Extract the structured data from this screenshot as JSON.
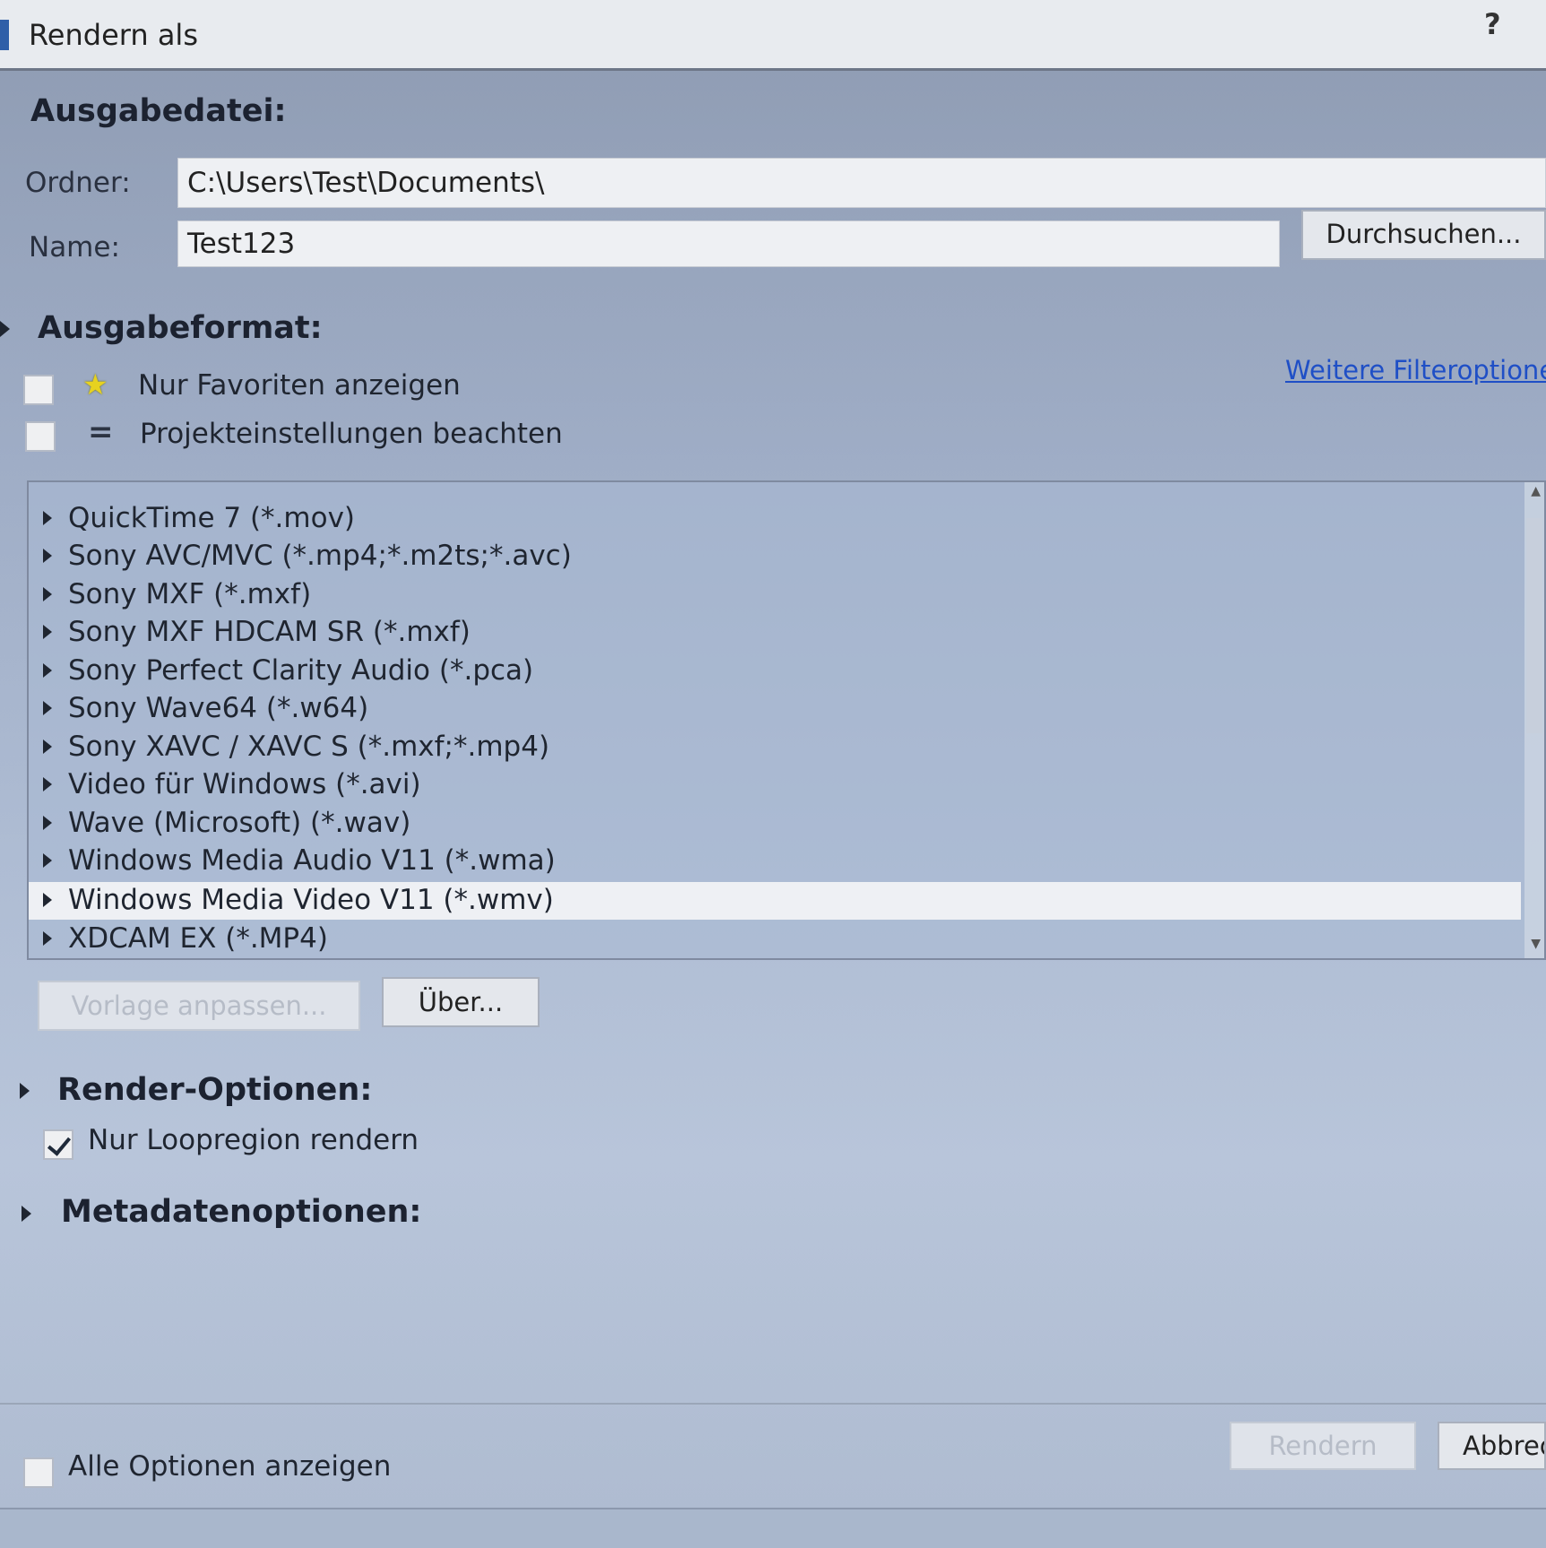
{
  "window": {
    "title": "Rendern als",
    "help": "?"
  },
  "output_file": {
    "heading": "Ausgabedatei:",
    "folder_label": "Ordner:",
    "folder_value": "C:\\Users\\Test\\Documents\\",
    "name_label": "Name:",
    "name_value": "Test123",
    "browse_label": "Durchsuchen..."
  },
  "output_format": {
    "heading": "Ausgabeformat:",
    "favorites_label": "Nur Favoriten anzeigen",
    "project_settings_label": "Projekteinstellungen beachten",
    "more_filters_link": "Weitere Filteroptione",
    "formats": [
      "QuickTime 7 (*.mov)",
      "Sony AVC/MVC (*.mp4;*.m2ts;*.avc)",
      "Sony MXF (*.mxf)",
      "Sony MXF HDCAM SR (*.mxf)",
      "Sony Perfect Clarity Audio (*.pca)",
      "Sony Wave64 (*.w64)",
      "Sony XAVC / XAVC S (*.mxf;*.mp4)",
      "Video für Windows (*.avi)",
      "Wave (Microsoft) (*.wav)",
      "Windows Media Audio V11 (*.wma)",
      "Windows Media Video V11 (*.wmv)",
      "XDCAM EX (*.MP4)"
    ],
    "selected_format": "Windows Media Video V11 (*.wmv)",
    "customize_template_label": "Vorlage anpassen...",
    "about_label": "Über..."
  },
  "render_options": {
    "heading": "Render-Optionen:",
    "loop_region_label": "Nur Loopregion rendern",
    "loop_region_checked": true
  },
  "metadata_options": {
    "heading": "Metadatenoptionen:"
  },
  "footer": {
    "show_all_label": "Alle Optionen anzeigen",
    "render_label": "Rendern",
    "cancel_label": "Abbrec"
  }
}
